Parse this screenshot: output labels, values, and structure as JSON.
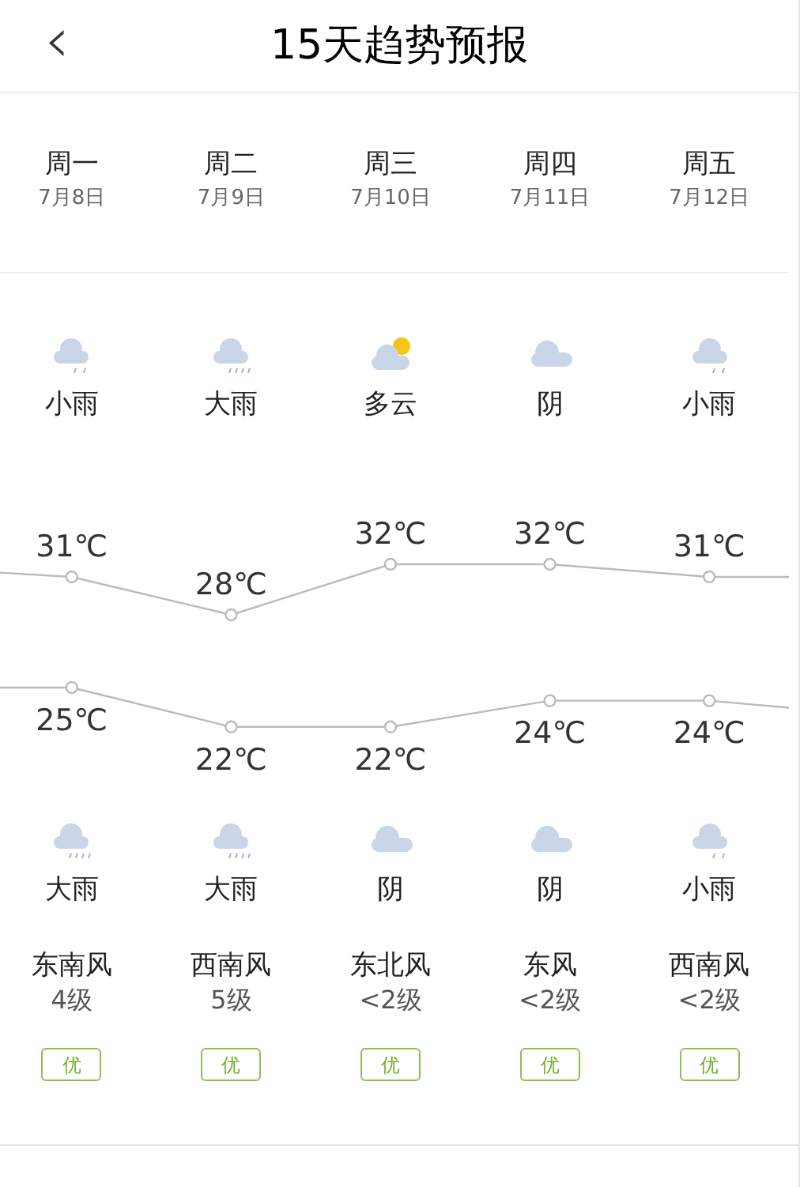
{
  "header": {
    "back": "‹",
    "title": "15天趋势预报"
  },
  "days": [
    {
      "weekday": "周一",
      "date": "7月8日",
      "day_icon": {
        "kind": "drizzle"
      },
      "day_weather": "小雨",
      "high": "31℃",
      "low": "25℃",
      "night_icon": {
        "kind": "downpour"
      },
      "night_weather": "大雨",
      "wind_dir": "东南风",
      "wind_level": "4级",
      "aqi": "优"
    },
    {
      "weekday": "周二",
      "date": "7月9日",
      "day_icon": {
        "kind": "downpour"
      },
      "day_weather": "大雨",
      "high": "28℃",
      "low": "22℃",
      "night_icon": {
        "kind": "downpour"
      },
      "night_weather": "大雨",
      "wind_dir": "西南风",
      "wind_level": "5级",
      "aqi": "优"
    },
    {
      "weekday": "周三",
      "date": "7月10日",
      "day_icon": {
        "kind": "partlycloudy"
      },
      "day_weather": "多云",
      "high": "32℃",
      "low": "22℃",
      "night_icon": {
        "kind": "overcast"
      },
      "night_weather": "阴",
      "wind_dir": "东北风",
      "wind_level": "<2级",
      "aqi": "优"
    },
    {
      "weekday": "周四",
      "date": "7月11日",
      "day_icon": {
        "kind": "overcast"
      },
      "day_weather": "阴",
      "high": "32℃",
      "low": "24℃",
      "night_icon": {
        "kind": "overcast"
      },
      "night_weather": "阴",
      "wind_dir": "东风",
      "wind_level": "<2级",
      "aqi": "优"
    },
    {
      "weekday": "周五",
      "date": "7月12日",
      "day_icon": {
        "kind": "drizzle"
      },
      "day_weather": "小雨",
      "high": "31℃",
      "low": "24℃",
      "night_icon": {
        "kind": "drizzle"
      },
      "night_weather": "小雨",
      "wind_dir": "西南风",
      "wind_level": "<2级",
      "aqi": "优"
    }
  ]
}
